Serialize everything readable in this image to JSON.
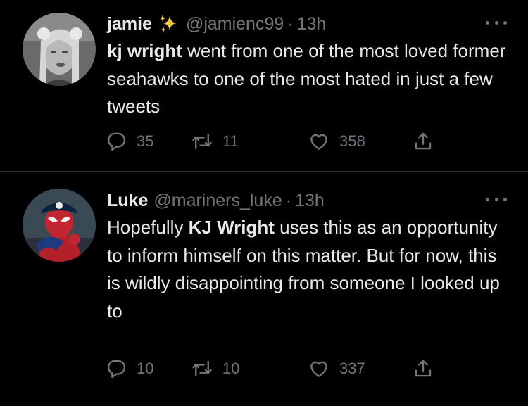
{
  "tweets": [
    {
      "name": "jamie",
      "name_emoji": "sparkles-emoji",
      "handle": "@jamienc99",
      "separator": "·",
      "time": "13h",
      "body": {
        "bold": "kj wright",
        "rest": " went from one of the most loved former seahawks to one of the most hated in just a few tweets"
      },
      "replies": "35",
      "retweets": "11",
      "likes": "358"
    },
    {
      "name": "Luke",
      "handle": "@mariners_luke",
      "separator": "·",
      "time": "13h",
      "body": {
        "pre": "Hopefully ",
        "bold": "KJ Wright",
        "rest": " uses this as an opportunity to inform himself on this matter. But for now, this is wildly disappointing from someone I looked up to"
      },
      "replies": "10",
      "retweets": "10",
      "likes": "337"
    }
  ],
  "icons": {
    "reply": "speech-bubble-icon",
    "retweet": "retweet-arrows-icon",
    "like": "heart-outline-icon",
    "share": "share-upload-icon",
    "more": "three-dots-icon"
  },
  "colors": {
    "background": "#000000",
    "text": "#e7e9ea",
    "muted": "#71767b",
    "divider": "#2f3336",
    "sparkle": "#f4c542"
  }
}
